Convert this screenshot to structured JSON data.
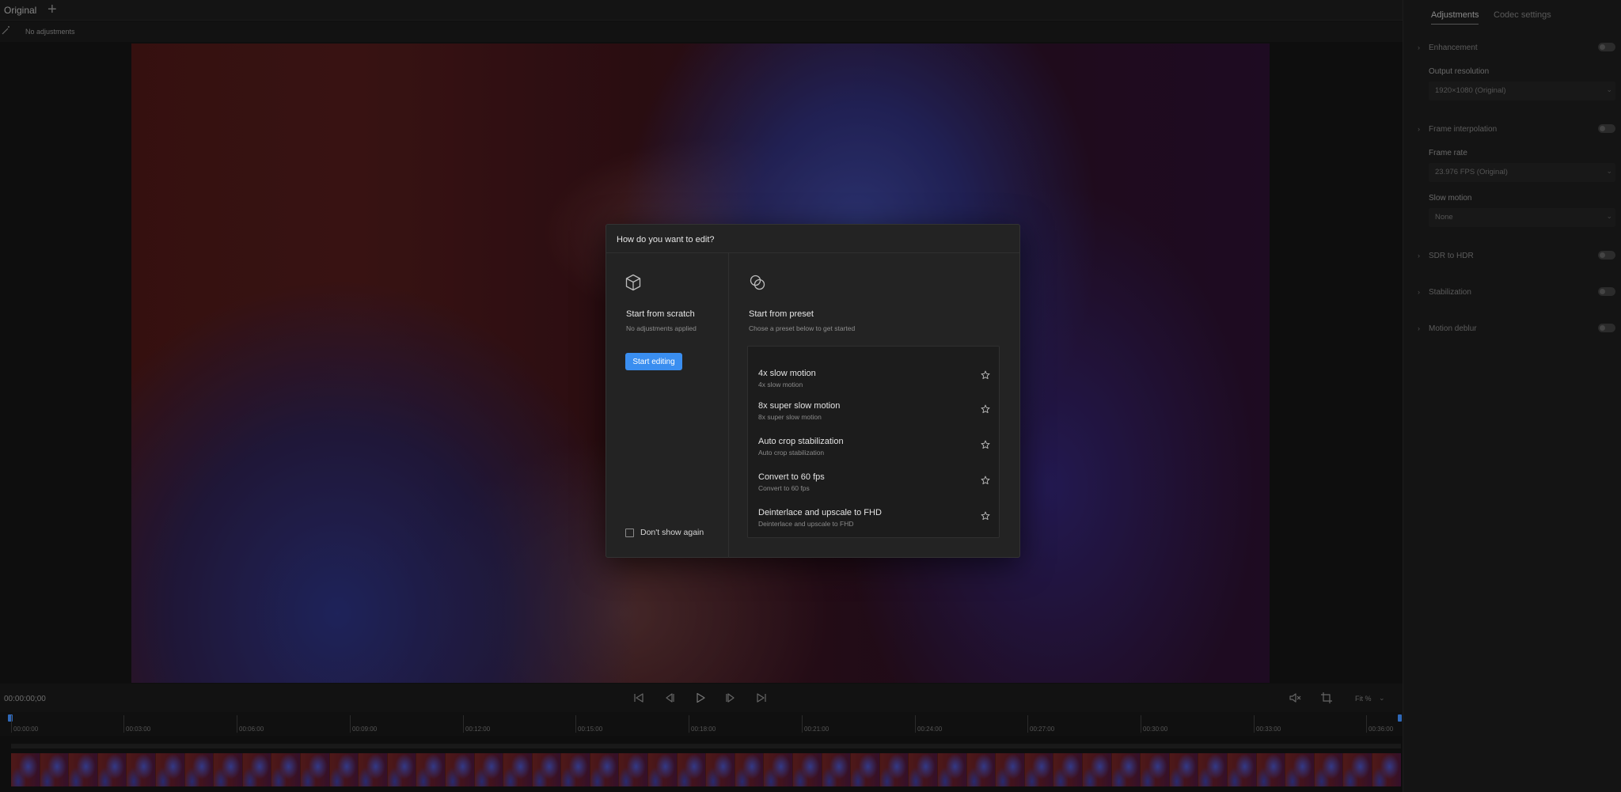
{
  "top_bar": {
    "tab_label": "Original",
    "add_tab_glyph": "+",
    "adjustments_status": "No adjustments"
  },
  "dialog": {
    "title": "How do you want to edit?",
    "scratch": {
      "title": "Start from scratch",
      "subtitle": "No adjustments applied",
      "button_label": "Start editing"
    },
    "dont_show_again": "Don't show again",
    "preset": {
      "title": "Start from preset",
      "subtitle": "Chose a preset below to get started",
      "items": [
        {
          "name": "4x slow motion",
          "description": "4x slow motion"
        },
        {
          "name": "8x super slow motion",
          "description": "8x super slow motion"
        },
        {
          "name": "Auto crop stabilization",
          "description": "Auto crop stabilization"
        },
        {
          "name": "Convert to 60 fps",
          "description": "Convert to 60 fps"
        },
        {
          "name": "Deinterlace and upscale to FHD",
          "description": "Deinterlace and upscale to FHD"
        }
      ]
    }
  },
  "right_panel": {
    "tabs": {
      "adjustments": "Adjustments",
      "codec": "Codec settings"
    },
    "sections": {
      "enhancement": "Enhancement",
      "output_resolution_label": "Output resolution",
      "output_resolution_value": "1920×1080 (Original)",
      "frame_interpolation": "Frame interpolation",
      "frame_rate_label": "Frame rate",
      "frame_rate_value": "23.976 FPS (Original)",
      "slow_motion_label": "Slow motion",
      "slow_motion_value": "None",
      "sdr_to_hdr": "SDR to HDR",
      "stabilization": "Stabilization",
      "motion_deblur": "Motion deblur"
    }
  },
  "transport": {
    "timecode": "00:00:00;00",
    "zoom_label": "Fit %"
  },
  "timeline": {
    "tick_labels": [
      "00:00:00",
      "00:03:00",
      "00:06:00",
      "00:09:00",
      "00:12:00",
      "00:15:00",
      "00:18:00",
      "00:21:00",
      "00:24:00",
      "00:27:00",
      "00:30:00",
      "00:33:00",
      "00:36:00"
    ]
  },
  "colors": {
    "accent": "#3a8ef0",
    "playhead": "#2f68b8",
    "dialog_bg": "#232323",
    "app_bg": "#0e0e0e"
  }
}
